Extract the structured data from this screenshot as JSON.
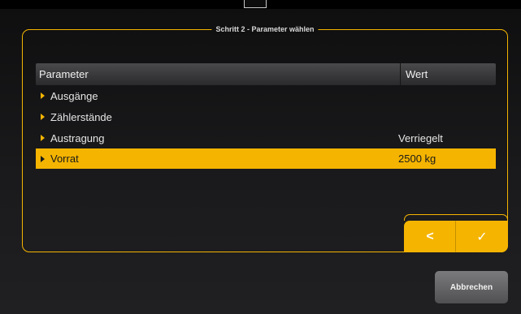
{
  "dialog": {
    "title": "Schritt 2 - Parameter wählen"
  },
  "table": {
    "headers": {
      "parameter": "Parameter",
      "value": "Wert"
    },
    "rows": [
      {
        "label": "Ausgänge",
        "value": ""
      },
      {
        "label": "Zählerstände",
        "value": ""
      },
      {
        "label": "Austragung",
        "value": "Verriegelt"
      },
      {
        "label": "Vorrat",
        "value": "2500 kg",
        "selected": true
      }
    ]
  },
  "nav": {
    "back_label": "<",
    "confirm_label": "✓"
  },
  "cancel_label": "Abbrechen",
  "colors": {
    "accent": "#f5b400",
    "background": "#000000",
    "header_gray": "#3a3a3c"
  }
}
